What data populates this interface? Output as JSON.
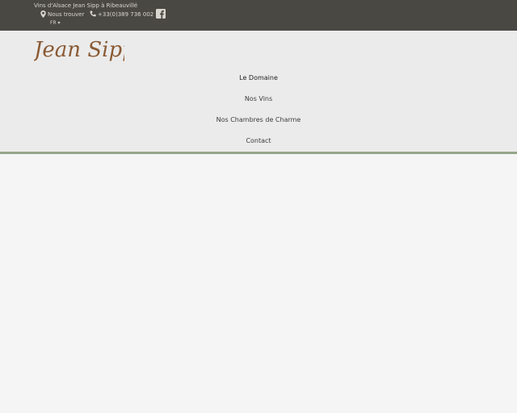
{
  "topbar": {
    "tagline": "Vins d'Alsace Jean Sipp à Ribeauvillé",
    "find_label": "Nous trouver",
    "phone": "+33(0)389 736 002",
    "language": "FR ▾"
  },
  "header": {
    "logo_text": "Jean Sipp"
  },
  "nav": {
    "items": [
      {
        "label": "Le Domaine"
      },
      {
        "label": "Nos Vins"
      },
      {
        "label": "Nos Chambres de Charme"
      },
      {
        "label": "Contact"
      }
    ]
  },
  "colors": {
    "topbar_bg": "#4a4843",
    "header_bg": "#ebebeb",
    "accent_line": "#96a68a",
    "logo_brown": "#8a5a34"
  },
  "icons": [
    "map-marker-icon",
    "phone-icon",
    "facebook-icon"
  ]
}
